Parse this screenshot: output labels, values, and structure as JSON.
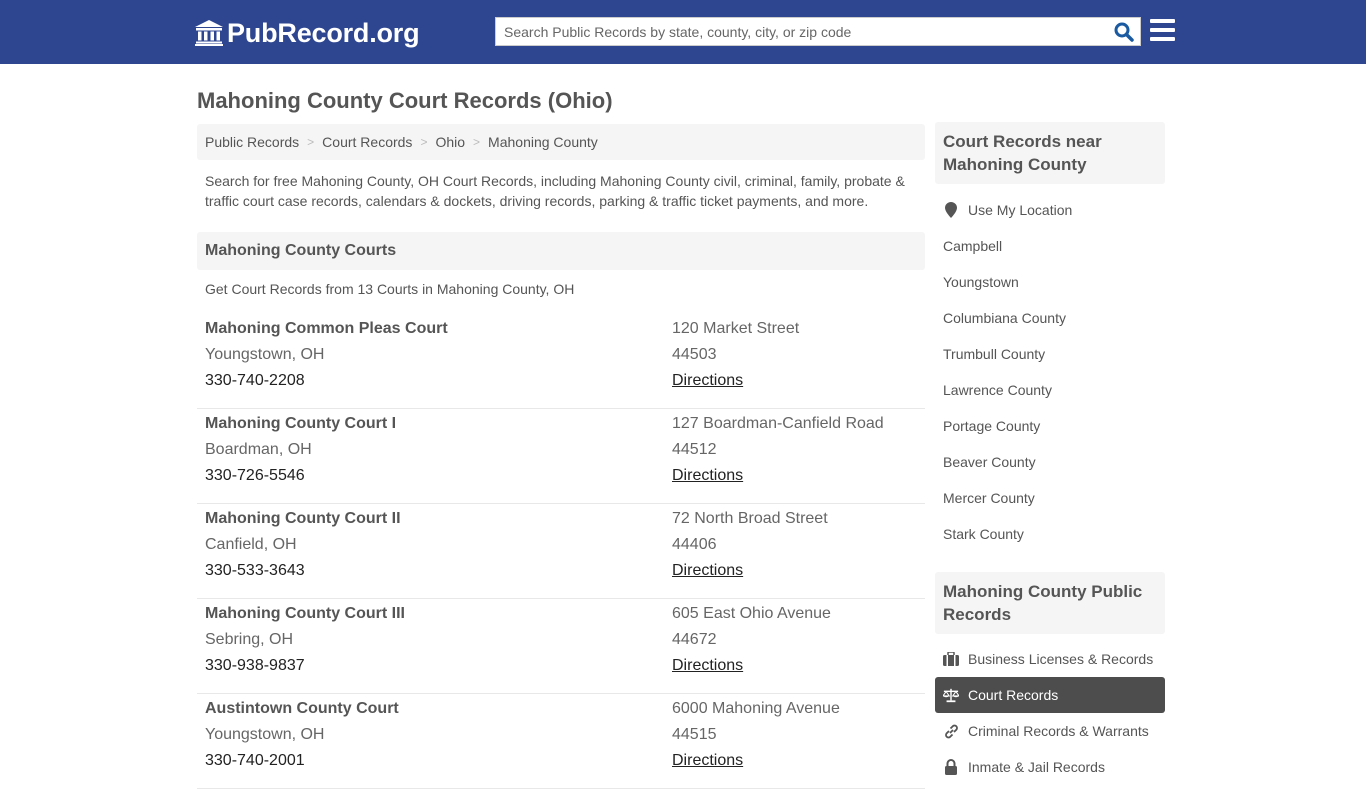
{
  "header": {
    "logo_text": "PubRecord.org",
    "search_placeholder": "Search Public Records by state, county, city, or zip code",
    "brand_color": "#2e4690"
  },
  "page": {
    "title": "Mahoning County Court Records (Ohio)",
    "breadcrumb": [
      "Public Records",
      "Court Records",
      "Ohio",
      "Mahoning County"
    ],
    "intro": "Search for free Mahoning County, OH Court Records, including Mahoning County civil, criminal, family, probate & traffic court case records, calendars & dockets, driving records, parking & traffic ticket payments, and more."
  },
  "courts_section": {
    "heading": "Mahoning County Courts",
    "subheading": "Get Court Records from 13 Courts in Mahoning County, OH",
    "directions_label": "Directions",
    "courts": [
      {
        "name": "Mahoning Common Pleas Court",
        "city": "Youngstown, OH",
        "phone": "330-740-2208",
        "address": "120 Market Street",
        "zip": "44503"
      },
      {
        "name": "Mahoning County Court I",
        "city": "Boardman, OH",
        "phone": "330-726-5546",
        "address": "127 Boardman-Canfield Road",
        "zip": "44512"
      },
      {
        "name": "Mahoning County Court II",
        "city": "Canfield, OH",
        "phone": "330-533-3643",
        "address": "72 North Broad Street",
        "zip": "44406"
      },
      {
        "name": "Mahoning County Court III",
        "city": "Sebring, OH",
        "phone": "330-938-9837",
        "address": "605 East Ohio Avenue",
        "zip": "44672"
      },
      {
        "name": "Austintown County Court",
        "city": "Youngstown, OH",
        "phone": "330-740-2001",
        "address": "6000 Mahoning Avenue",
        "zip": "44515"
      }
    ]
  },
  "sidebar": {
    "nearby_heading": "Court Records near Mahoning County",
    "use_location": "Use My Location",
    "nearby": [
      "Campbell",
      "Youngstown",
      "Columbiana County",
      "Trumbull County",
      "Lawrence County",
      "Portage County",
      "Beaver County",
      "Mercer County",
      "Stark County"
    ],
    "public_heading": "Mahoning County Public Records",
    "public_items": [
      {
        "label": "Business Licenses & Records",
        "icon": "briefcase-icon",
        "active": false
      },
      {
        "label": "Court Records",
        "icon": "scales-icon",
        "active": true
      },
      {
        "label": "Criminal Records & Warrants",
        "icon": "link-icon",
        "active": false
      },
      {
        "label": "Inmate & Jail Records",
        "icon": "lock-icon",
        "active": false
      }
    ]
  }
}
